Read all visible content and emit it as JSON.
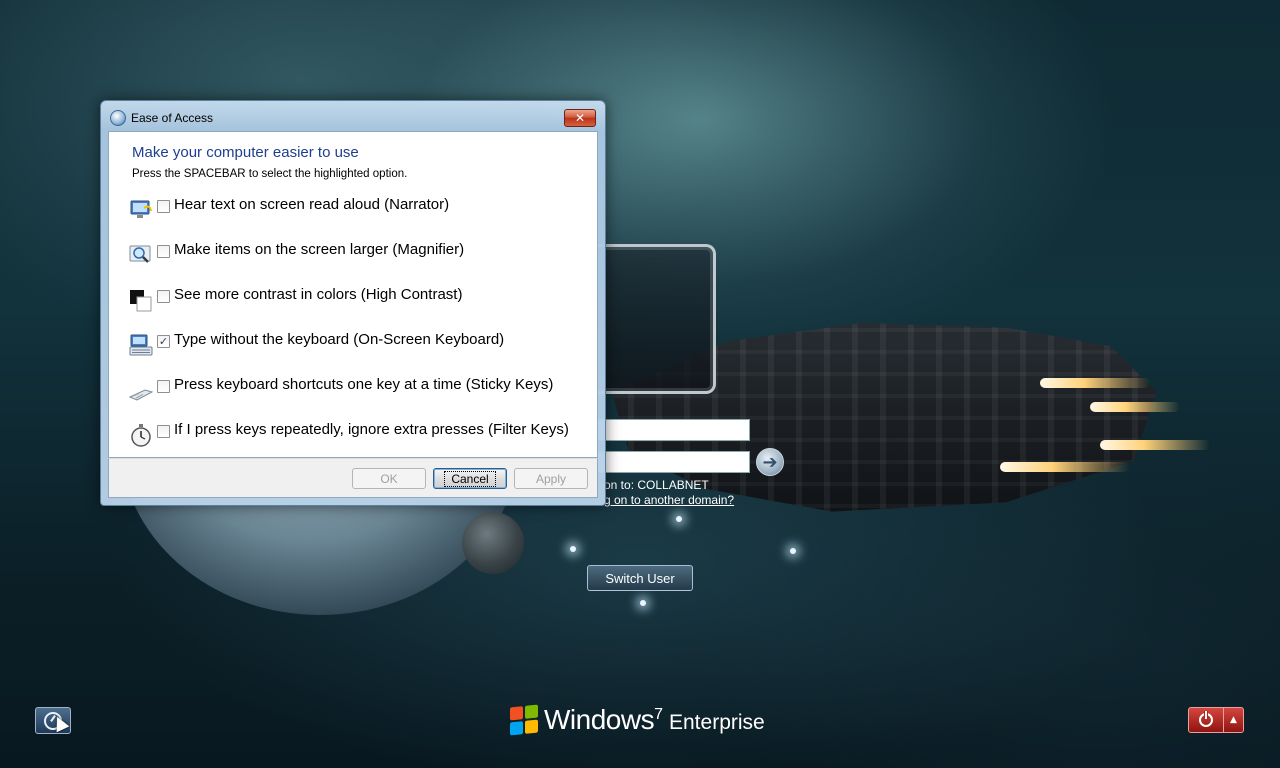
{
  "dialog": {
    "title": "Ease of Access",
    "heading": "Make your computer easier to use",
    "subtitle": "Press the SPACEBAR to select the highlighted option.",
    "options": [
      {
        "label": "Hear text on screen read aloud (Narrator)",
        "checked": false,
        "icon": "narrator-icon"
      },
      {
        "label": "Make items on the screen larger (Magnifier)",
        "checked": false,
        "icon": "magnifier-icon"
      },
      {
        "label": "See more contrast in colors (High Contrast)",
        "checked": false,
        "icon": "high-contrast-icon"
      },
      {
        "label": "Type without the keyboard (On-Screen Keyboard)",
        "checked": true,
        "icon": "keyboard-icon"
      },
      {
        "label": "Press keyboard shortcuts one key at a time (Sticky Keys)",
        "checked": false,
        "icon": "sticky-keys-icon"
      },
      {
        "label": "If I press keys repeatedly, ignore extra presses (Filter Keys)",
        "checked": false,
        "icon": "stopwatch-icon"
      }
    ],
    "buttons": {
      "ok": "OK",
      "cancel": "Cancel",
      "apply": "Apply"
    },
    "close_glyph": "✕"
  },
  "logon": {
    "domain_text": "on to: COLLABNET",
    "other_domain_link": "g on to another domain?",
    "switch_user": "Switch User",
    "arrow_glyph": "➔"
  },
  "branding": {
    "windows": "Windows",
    "version": "7",
    "edition": "Enterprise",
    "logo_colors": [
      "#f25022",
      "#7fba00",
      "#00a4ef",
      "#ffb900"
    ]
  },
  "power": {
    "arrow_glyph": "▲"
  }
}
